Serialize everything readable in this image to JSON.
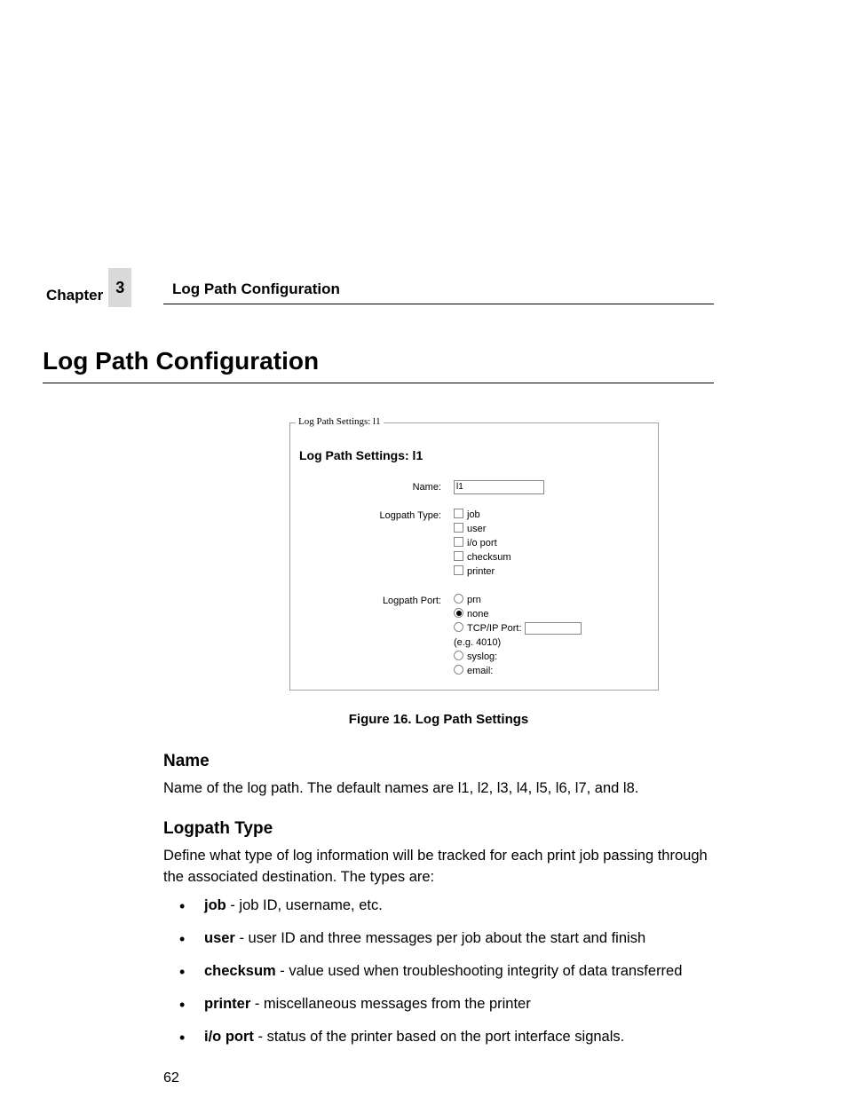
{
  "header": {
    "chapter_word": "Chapter",
    "chapter_number": "3",
    "section_title": "Log Path Configuration"
  },
  "main_heading": "Log Path Configuration",
  "figure": {
    "legend": "Log Path Settings: l1",
    "subtitle": "Log Path Settings: l1",
    "name_label": "Name:",
    "name_value": "l1",
    "type_label": "Logpath Type:",
    "type_options": [
      "job",
      "user",
      "i/o port",
      "checksum",
      "printer"
    ],
    "port_label": "Logpath Port:",
    "port_options": {
      "prn": "prn",
      "none": "none",
      "tcpip": "TCP/IP Port:",
      "tcpip_hint": "(e.g. 4010)",
      "syslog": "syslog:",
      "email": "email:"
    },
    "caption": "Figure 16. Log Path Settings"
  },
  "sections": {
    "name": {
      "heading": "Name",
      "body": "Name of the log path. The default names are l1, l2, l3, l4, l5, l6, l7, and l8."
    },
    "logpath_type": {
      "heading": "Logpath Type",
      "intro": "Define what type of log information will be tracked for each print job passing through the associated destination. The types are:",
      "items": [
        {
          "term": "job",
          "desc": " - job ID, username, etc."
        },
        {
          "term": "user",
          "desc": " - user ID and three messages per job about the start and finish"
        },
        {
          "term": "checksum",
          "desc": " - value used when troubleshooting integrity of data transferred"
        },
        {
          "term": "printer",
          "desc": " - miscellaneous messages from the printer"
        },
        {
          "term": "i/o port",
          "desc": " - status of the printer based on the port interface signals."
        }
      ]
    }
  },
  "page_number": "62"
}
